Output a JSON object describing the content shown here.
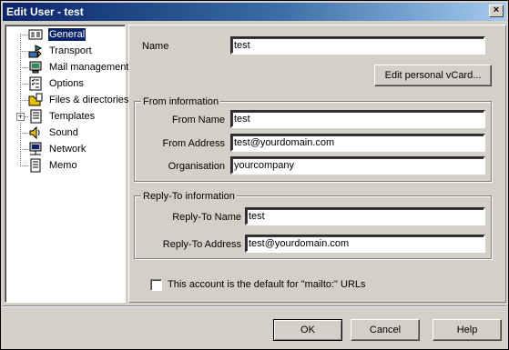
{
  "window": {
    "title": "Edit User - test",
    "close_label": "×"
  },
  "tree": {
    "items": [
      {
        "label": "General",
        "icon": "user-card-icon",
        "selected": true
      },
      {
        "label": "Transport",
        "icon": "transport-icon"
      },
      {
        "label": "Mail management",
        "icon": "mail-management-icon"
      },
      {
        "label": "Options",
        "icon": "options-checklist-icon"
      },
      {
        "label": "Files & directories",
        "icon": "folder-files-icon"
      },
      {
        "label": "Templates",
        "icon": "templates-icon",
        "expandable": true
      },
      {
        "label": "Sound",
        "icon": "speaker-icon"
      },
      {
        "label": "Network",
        "icon": "network-computer-icon"
      },
      {
        "label": "Memo",
        "icon": "memo-icon"
      }
    ],
    "expander_label": "+"
  },
  "general": {
    "name_label": "Name",
    "name_value": "test",
    "vcard_button": "Edit personal vCard..."
  },
  "from_info": {
    "title": "From information",
    "from_name_label": "From Name",
    "from_name_value": "test",
    "from_address_label": "From Address",
    "from_address_value": "test@yourdomain.com",
    "organisation_label": "Organisation",
    "organisation_value": "yourcompany"
  },
  "reply_to": {
    "title": "Reply-To information",
    "name_label": "Reply-To Name",
    "name_value": "test",
    "address_label": "Reply-To Address",
    "address_value": "test@yourdomain.com"
  },
  "default_checkbox": {
    "label": "This account is the default for \"mailto:\" URLs",
    "checked": false
  },
  "buttons": {
    "ok": "OK",
    "cancel": "Cancel",
    "help": "Help"
  }
}
